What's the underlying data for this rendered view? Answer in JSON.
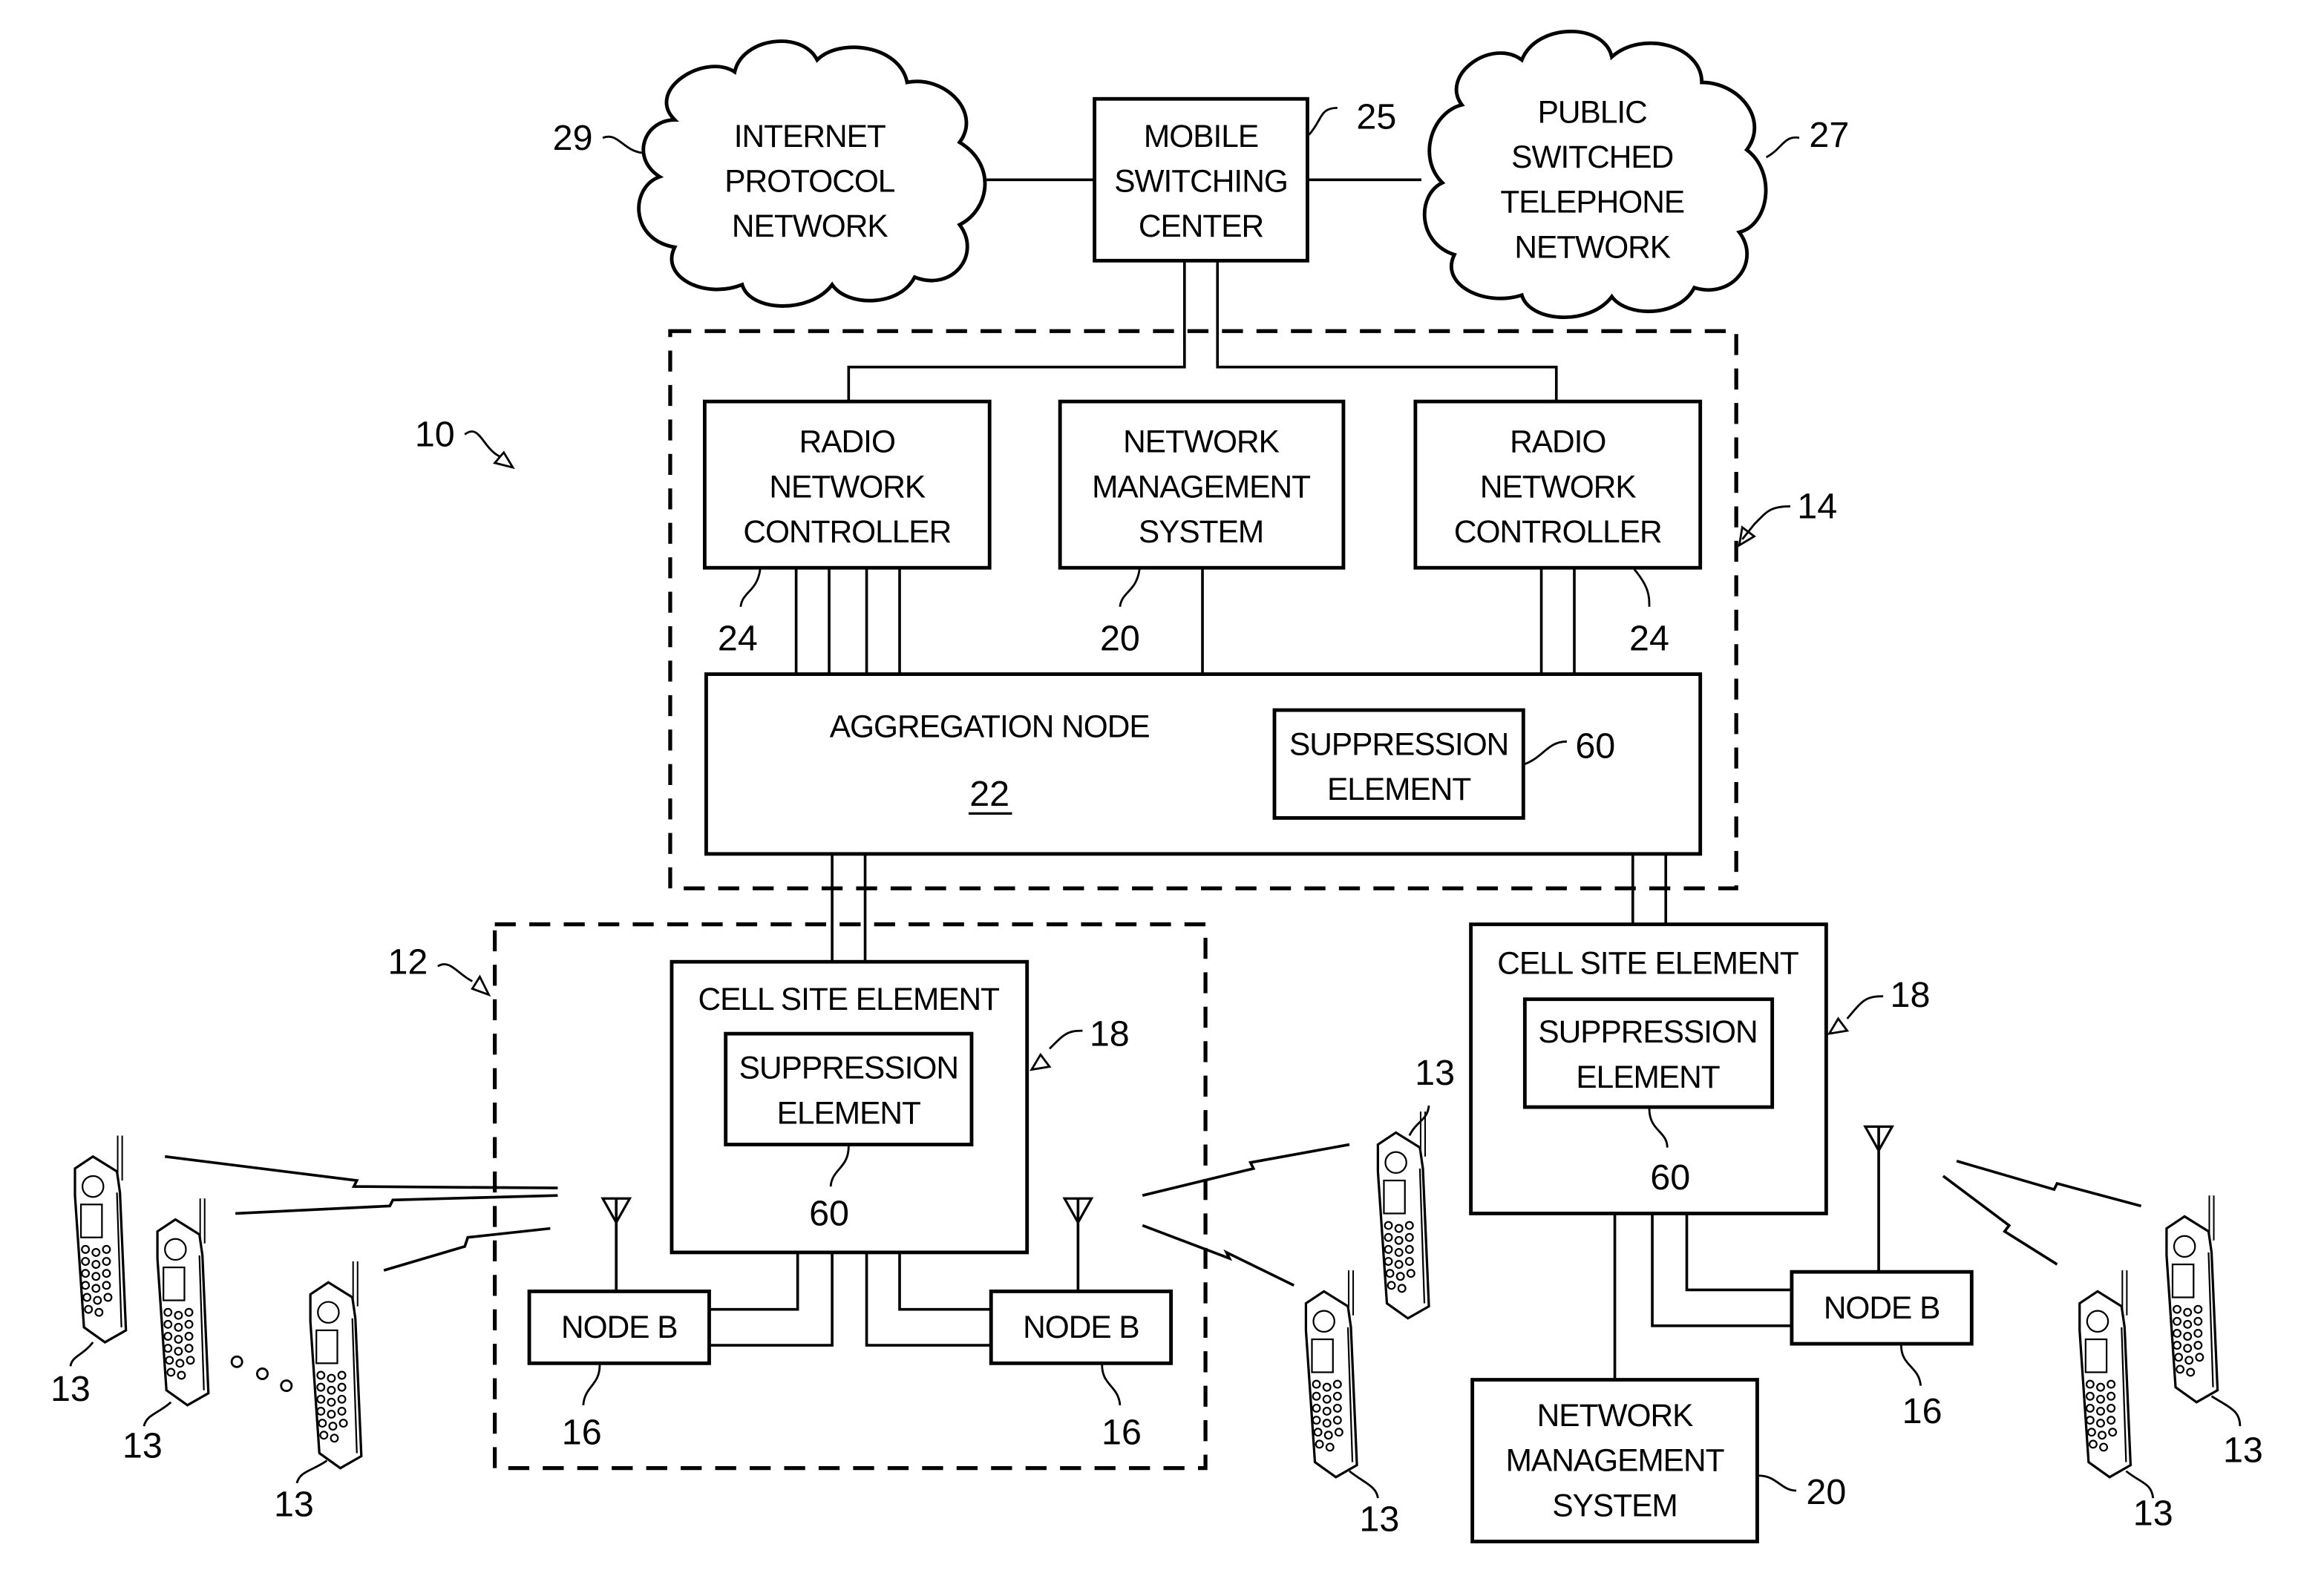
{
  "figure": {
    "system_ref": "10",
    "clouds": {
      "ip_network": {
        "lines": [
          "INTERNET",
          "PROTOCOL",
          "NETWORK"
        ],
        "ref": "29"
      },
      "pstn": {
        "lines": [
          "PUBLIC",
          "SWITCHED",
          "TELEPHONE",
          "NETWORK"
        ],
        "ref": "27"
      }
    },
    "msc": {
      "lines": [
        "MOBILE",
        "SWITCHING",
        "CENTER"
      ],
      "ref": "25"
    },
    "core_region": {
      "ref": "14"
    },
    "rnc_left": {
      "lines": [
        "RADIO",
        "NETWORK",
        "CONTROLLER"
      ],
      "ref": "24"
    },
    "nms_core": {
      "lines": [
        "NETWORK",
        "MANAGEMENT",
        "SYSTEM"
      ],
      "ref": "20"
    },
    "rnc_right": {
      "lines": [
        "RADIO",
        "NETWORK",
        "CONTROLLER"
      ],
      "ref": "24"
    },
    "aggregation_node": {
      "label": "AGGREGATION NODE",
      "ref": "22"
    },
    "aggregation_suppression": {
      "lines": [
        "SUPPRESSION",
        "ELEMENT"
      ],
      "ref": "60"
    },
    "cell_region": {
      "ref": "12"
    },
    "cell_site_left": {
      "label": "CELL SITE ELEMENT",
      "ref": "18",
      "suppression": {
        "lines": [
          "SUPPRESSION",
          "ELEMENT"
        ],
        "ref": "60"
      }
    },
    "cell_site_right": {
      "label": "CELL SITE ELEMENT",
      "ref": "18",
      "suppression": {
        "lines": [
          "SUPPRESSION",
          "ELEMENT"
        ],
        "ref": "60"
      }
    },
    "node_b_left": {
      "label": "NODE B",
      "ref": "16"
    },
    "node_b_middle": {
      "label": "NODE B",
      "ref": "16"
    },
    "node_b_right": {
      "label": "NODE B",
      "ref": "16"
    },
    "nms_site": {
      "lines": [
        "NETWORK",
        "MANAGEMENT",
        "SYSTEM"
      ],
      "ref": "20"
    },
    "mobile_ref": "13"
  }
}
